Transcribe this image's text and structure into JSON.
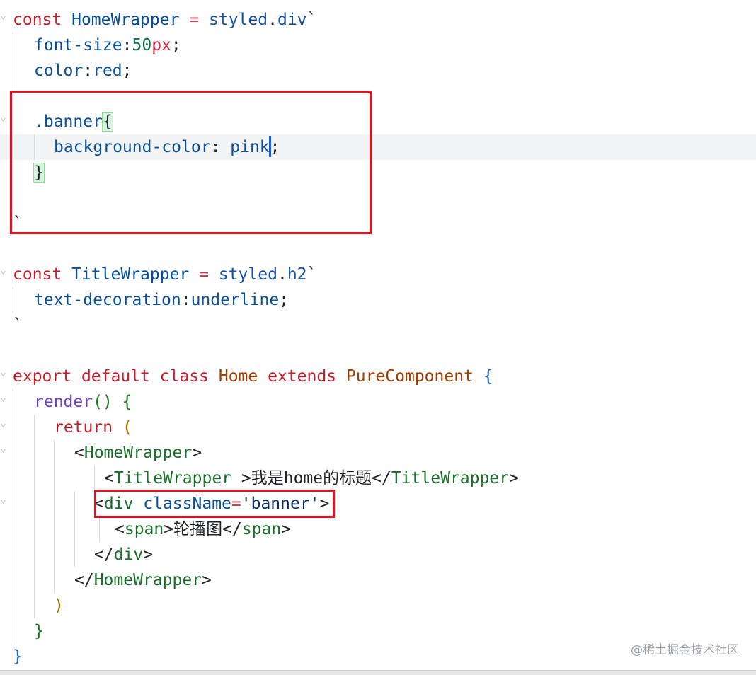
{
  "editor": {
    "lines": [
      {
        "id": 1,
        "segments": [
          [
            "kw",
            "const"
          ],
          [
            "plain",
            " "
          ],
          [
            "cls",
            "HomeWrapper"
          ],
          [
            "plain",
            " "
          ],
          [
            "tpl",
            "="
          ],
          [
            "plain",
            " "
          ],
          [
            "fn",
            "styled"
          ],
          [
            "plain",
            "."
          ],
          [
            "fn",
            "div"
          ],
          [
            "plain",
            "`"
          ]
        ]
      },
      {
        "id": 2,
        "segments": [
          [
            "prop",
            "font-size"
          ],
          [
            "plain",
            ":"
          ],
          [
            "num",
            "50"
          ],
          [
            "unit",
            "px"
          ],
          [
            "plain",
            ";"
          ]
        ]
      },
      {
        "id": 3,
        "segments": [
          [
            "prop",
            "color"
          ],
          [
            "plain",
            ":"
          ],
          [
            "prop",
            "red"
          ],
          [
            "plain",
            ";"
          ]
        ]
      },
      {
        "id": 4,
        "segments": []
      },
      {
        "id": 5,
        "segments": [
          [
            "prop",
            ".banner"
          ],
          [
            "bm",
            "{"
          ]
        ]
      },
      {
        "id": 6,
        "segments": [
          [
            "prop",
            "background-color"
          ],
          [
            "plain",
            ": "
          ],
          [
            "prop",
            "pink"
          ],
          [
            "caret",
            ""
          ],
          [
            "plain",
            ";"
          ]
        ]
      },
      {
        "id": 7,
        "segments": [
          [
            "bm",
            "}"
          ]
        ]
      },
      {
        "id": 8,
        "segments": []
      },
      {
        "id": 9,
        "segments": [
          [
            "plain",
            "`"
          ]
        ]
      },
      {
        "id": 10,
        "segments": []
      },
      {
        "id": 11,
        "segments": [
          [
            "kw",
            "const"
          ],
          [
            "plain",
            " "
          ],
          [
            "cls",
            "TitleWrapper"
          ],
          [
            "plain",
            " "
          ],
          [
            "tpl",
            "="
          ],
          [
            "plain",
            " "
          ],
          [
            "fn",
            "styled"
          ],
          [
            "plain",
            "."
          ],
          [
            "fn",
            "h2"
          ],
          [
            "plain",
            "`"
          ]
        ]
      },
      {
        "id": 12,
        "segments": [
          [
            "prop",
            "text-decoration"
          ],
          [
            "plain",
            ":"
          ],
          [
            "prop",
            "underline"
          ],
          [
            "plain",
            ";"
          ]
        ]
      },
      {
        "id": 13,
        "segments": [
          [
            "plain",
            "`"
          ]
        ]
      },
      {
        "id": 14,
        "segments": []
      },
      {
        "id": 15,
        "segments": [
          [
            "kw",
            "export"
          ],
          [
            "plain",
            " "
          ],
          [
            "kw",
            "default"
          ],
          [
            "plain",
            " "
          ],
          [
            "kw",
            "class"
          ],
          [
            "plain",
            " "
          ],
          [
            "type",
            "Home"
          ],
          [
            "plain",
            " "
          ],
          [
            "kw",
            "extends"
          ],
          [
            "plain",
            " "
          ],
          [
            "type",
            "PureComponent"
          ],
          [
            "plain",
            " "
          ],
          [
            "brace",
            "{"
          ]
        ]
      },
      {
        "id": 16,
        "segments": [
          [
            "mfn",
            "render"
          ],
          [
            "paren2",
            "()"
          ],
          [
            "plain",
            " "
          ],
          [
            "brace2",
            "{"
          ]
        ]
      },
      {
        "id": 17,
        "segments": [
          [
            "kw",
            "return"
          ],
          [
            "plain",
            " "
          ],
          [
            "paren",
            "("
          ]
        ]
      },
      {
        "id": 18,
        "segments": [
          [
            "plain",
            "<"
          ],
          [
            "tag",
            "HomeWrapper"
          ],
          [
            "plain",
            ">"
          ]
        ]
      },
      {
        "id": 19,
        "segments": [
          [
            "plain",
            "<"
          ],
          [
            "tag",
            "TitleWrapper"
          ],
          [
            "plain",
            " >"
          ],
          [
            "plain",
            "我是home的标题"
          ],
          [
            "plain",
            "</"
          ],
          [
            "tag",
            "TitleWrapper"
          ],
          [
            "plain",
            ">"
          ]
        ]
      },
      {
        "id": 20,
        "segments": [
          [
            "plain",
            "<"
          ],
          [
            "tag",
            "div"
          ],
          [
            "plain",
            " "
          ],
          [
            "attr",
            "className"
          ],
          [
            "tpl",
            "="
          ],
          [
            "str",
            "'banner'"
          ],
          [
            "plain",
            ">"
          ]
        ]
      },
      {
        "id": 21,
        "segments": [
          [
            "plain",
            "<"
          ],
          [
            "tag",
            "span"
          ],
          [
            "plain",
            ">"
          ],
          [
            "plain",
            "轮播图"
          ],
          [
            "plain",
            "</"
          ],
          [
            "tag",
            "span"
          ],
          [
            "plain",
            ">"
          ]
        ]
      },
      {
        "id": 22,
        "segments": [
          [
            "plain",
            "</"
          ],
          [
            "tag",
            "div"
          ],
          [
            "plain",
            ">"
          ]
        ]
      },
      {
        "id": 23,
        "segments": [
          [
            "plain",
            "</"
          ],
          [
            "tag",
            "HomeWrapper"
          ],
          [
            "plain",
            ">"
          ]
        ]
      },
      {
        "id": 24,
        "segments": [
          [
            "paren",
            ")"
          ]
        ]
      },
      {
        "id": 25,
        "segments": [
          [
            "brace2",
            "}"
          ]
        ]
      },
      {
        "id": 26,
        "segments": [
          [
            "brace",
            "}"
          ]
        ]
      }
    ]
  },
  "watermark": "@稀土掘金技术社区",
  "colors": {
    "highlight_box": "#e0141e",
    "caret": "#1f5bd6",
    "bracket_match": "#d6f5dc"
  }
}
